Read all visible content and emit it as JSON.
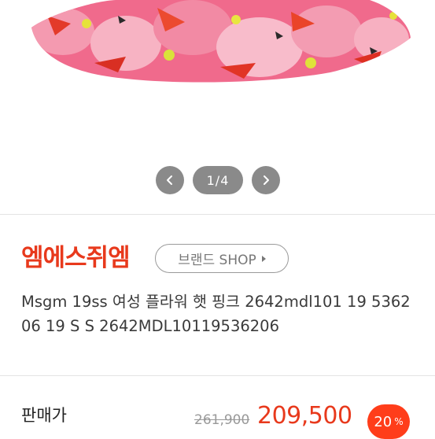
{
  "gallery": {
    "counter_text": "1/4",
    "prev_icon": "chevron-left-icon",
    "next_icon": "chevron-right-icon"
  },
  "brand": {
    "name": "엠에스쥐엠",
    "shop_label": "브랜드 SHOP",
    "shop_arrow_icon": "caret-right-icon"
  },
  "product": {
    "title": "Msgm 19ss 여성 플라워 햇 핑크 2642mdl101 19 5362 06 19 S S 2642MDL10119536206"
  },
  "price": {
    "label": "판매가",
    "original": "261,900",
    "sale": "209,500",
    "discount_value": "20",
    "discount_unit": "%"
  },
  "colors": {
    "accent": "#e8391c",
    "badge": "#ff3d1a",
    "nav": "#8a8a8a"
  }
}
